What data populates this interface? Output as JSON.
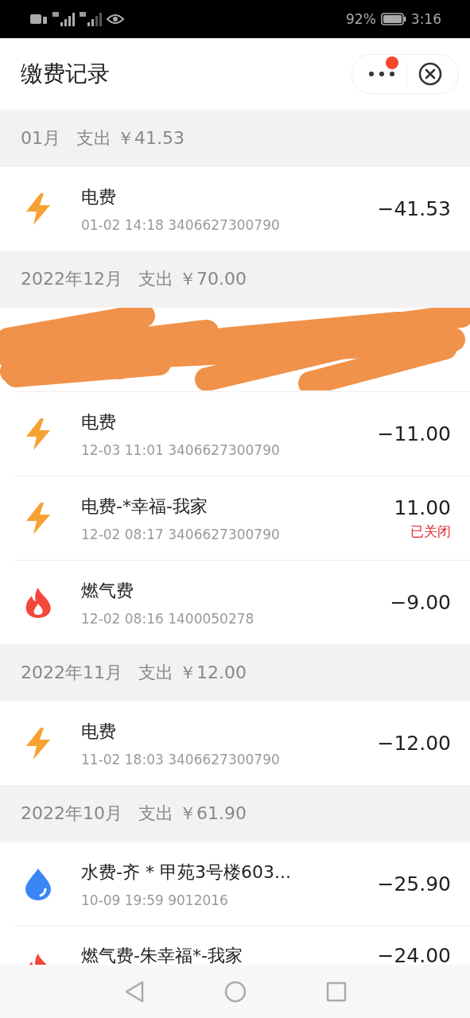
{
  "status_bar": {
    "battery": "92%",
    "time": "3:16"
  },
  "header": {
    "title": "缴费记录",
    "more_badge": true
  },
  "groups": [
    {
      "month": "01月",
      "summary": "支出 ￥41.53",
      "items": [
        {
          "kind": "electric",
          "title": "电费",
          "meta": "01-02 14:18 3406627300790",
          "amount": "−41.53"
        }
      ]
    },
    {
      "month": "2022年12月",
      "summary": "支出 ￥70.00",
      "items": [
        {
          "kind": "redacted"
        },
        {
          "kind": "electric",
          "title": "电费",
          "meta": "12-03 11:01 3406627300790",
          "amount": "−11.00"
        },
        {
          "kind": "electric",
          "title": "电费-*幸福-我家",
          "meta": "12-02 08:17 3406627300790",
          "amount": "11.00",
          "status": "已关闭"
        },
        {
          "kind": "gas",
          "title": "燃气费",
          "meta": "12-02 08:16 1400050278",
          "amount": "−9.00"
        }
      ]
    },
    {
      "month": "2022年11月",
      "summary": "支出 ￥12.00",
      "items": [
        {
          "kind": "electric",
          "title": "电费",
          "meta": "11-02 18:03 3406627300790",
          "amount": "−12.00"
        }
      ]
    },
    {
      "month": "2022年10月",
      "summary": "支出 ￥61.90",
      "items": [
        {
          "kind": "water",
          "title": "水费-齐 * 甲苑3号楼603...",
          "meta": "10-09 19:59 9012016",
          "amount": "−25.90"
        },
        {
          "kind": "gas",
          "title": "燃气费-朱幸福*-我家",
          "amount": "−24.00"
        }
      ]
    }
  ]
}
